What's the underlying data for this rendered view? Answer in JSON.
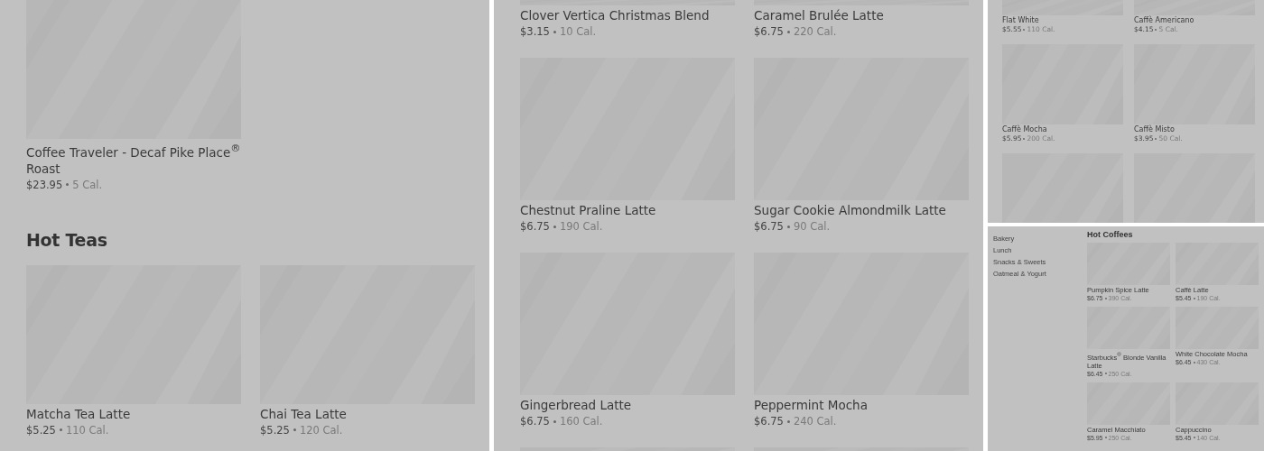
{
  "panels": [
    {
      "kind": "large",
      "groups": [
        {
          "items": [
            {
              "name": "Coffee Traveler - Decaf Pike Place$^{®}$ Roast",
              "price": "$23.95",
              "calories": "5 Cal."
            }
          ]
        },
        {
          "heading": "Hot Teas",
          "items": [
            {
              "name": "Matcha Tea Latte",
              "price": "$5.25",
              "calories": "110 Cal."
            },
            {
              "name": "Chai Tea Latte",
              "price": "$5.25",
              "calories": "120 Cal."
            }
          ]
        }
      ]
    },
    {
      "kind": "large",
      "groups": [
        {
          "items": [
            {
              "name": "Clover Vertica Christmas Blend",
              "price": "$3.15",
              "calories": "10 Cal."
            },
            {
              "name": "Caramel Brulée Latte",
              "price": "$6.75",
              "calories": "220 Cal."
            },
            {
              "name": "Chestnut Praline Latte",
              "price": "$6.75",
              "calories": "190 Cal."
            },
            {
              "name": "Sugar Cookie Almondmilk Latte",
              "price": "$6.75",
              "calories": "90 Cal."
            },
            {
              "name": "Gingerbread Latte",
              "price": "$6.75",
              "calories": "160 Cal."
            },
            {
              "name": "Peppermint Mocha",
              "price": "$6.75",
              "calories": "240 Cal."
            }
          ]
        }
      ]
    },
    {
      "kind": "small",
      "groups": [
        {
          "items": [
            {
              "name": "Flat White",
              "price": "$5.55",
              "calories": "110 Cal."
            },
            {
              "name": "Caffè Americano",
              "price": "$4.15",
              "calories": "5 Cal."
            },
            {
              "name": "Caffè Mocha",
              "price": "$5.95",
              "calories": "200 Cal."
            },
            {
              "name": "Caffè Misto",
              "price": "$3.95",
              "calories": "50 Cal."
            }
          ]
        }
      ]
    },
    {
      "kind": "tiny",
      "sidebar": [
        "Bakery",
        "Lunch",
        "Snacks & Sweets",
        "Oatmeal & Yogurt"
      ],
      "groups": [
        {
          "heading": "Hot Coffees",
          "items": [
            {
              "name": "Pumpkin Spice Latte",
              "price": "$6.75",
              "calories": "390 Cal."
            },
            {
              "name": "Caffè Latte",
              "price": "$5.45",
              "calories": "190 Cal."
            },
            {
              "name": "Starbucks$^{®}$ Blonde Vanilla Latte",
              "price": "$6.45",
              "calories": "250 Cal."
            },
            {
              "name": "White Chocolate Mocha",
              "price": "$6.45",
              "calories": "430 Cal."
            },
            {
              "name": "Caramel Macchiato",
              "price": "$5.95",
              "calories": "250 Cal."
            },
            {
              "name": "Cappuccino",
              "price": "$5.45",
              "calories": "140 Cal."
            }
          ]
        }
      ]
    }
  ]
}
